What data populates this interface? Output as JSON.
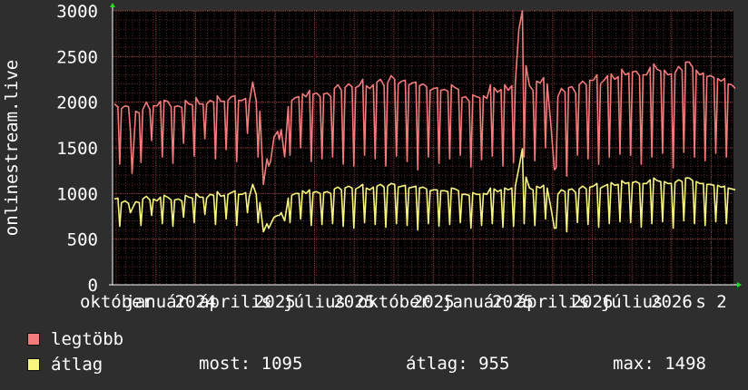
{
  "chart_data": {
    "type": "line",
    "ylabel": "onlinestream.live",
    "ylim": [
      0,
      3000
    ],
    "yticks": [
      0,
      500,
      1000,
      1500,
      2000,
      2500,
      3000
    ],
    "x_tick_labels": [
      "október",
      "január",
      "2024",
      "április",
      "2025",
      "július",
      "2025",
      "október",
      "2025",
      "január",
      "2025",
      "április",
      "2026",
      "július",
      "2026",
      "s 2"
    ],
    "grid": true,
    "series": [
      {
        "name": "legtöbb",
        "color": "#f47b7b",
        "values": [
          1980,
          1950,
          1930,
          1960,
          1950,
          1220,
          1900,
          1880,
          1920,
          2000,
          1920,
          1960,
          1960,
          2010,
          2020,
          2010,
          1950,
          1950,
          1960,
          1940,
          2020,
          1980,
          1970,
          2050,
          1980,
          1980,
          1980,
          2020,
          2000,
          2070,
          2010,
          2010,
          2020,
          2060,
          2070,
          2020,
          2020,
          2040,
          1990,
          2220,
          2010,
          1900,
          1100,
          1380,
          1350,
          1620,
          1680,
          1700,
          1400,
          1950,
          2020,
          2050,
          2060,
          2090,
          2060,
          2130,
          2090,
          2100,
          2060,
          2090,
          2100,
          2060,
          2150,
          2190,
          2130,
          2160,
          2200,
          2170,
          2160,
          2180,
          2250,
          2180,
          2150,
          2190,
          2220,
          2250,
          2180,
          2210,
          2290,
          2250,
          2200,
          2230,
          2240,
          2190,
          2210,
          2220,
          2180,
          2200,
          2170,
          2130,
          2150,
          2160,
          2130,
          2140,
          2120,
          2190,
          2160,
          2140,
          2050,
          2060,
          2010,
          2080,
          2060,
          2050,
          2070,
          2040,
          2190,
          2160,
          2110,
          2140,
          2190,
          2130,
          2180,
          2210,
          2800,
          3000,
          2400,
          2180,
          2130,
          2230,
          2210,
          2270,
          2200,
          1760,
          1260,
          2060,
          2150,
          2110,
          2160,
          2170,
          2100,
          2190,
          2230,
          2190,
          2240,
          2240,
          2300,
          2200,
          2240,
          2290,
          2310,
          2250,
          2280,
          2360,
          2300,
          2320,
          2330,
          2340,
          2290,
          2300,
          2300,
          2380,
          2420,
          2360,
          2340,
          2350,
          2300,
          2310,
          2320,
          2390,
          2350,
          2440,
          2440,
          2380,
          2350,
          2300,
          2320,
          2280,
          2290,
          2270,
          2260,
          2230,
          2260,
          2200,
          2190,
          2150
        ],
        "dips": [
          1320,
          1700,
          1340,
          1580,
          1400,
          1330,
          1550,
          1410,
          1600,
          1380,
          1480,
          1350,
          1660,
          1400,
          1300,
          1590,
          1420,
          1500,
          1350,
          1380,
          1400,
          1320,
          1300,
          1420,
          1380,
          1300,
          1410,
          1350,
          1260,
          1400,
          1330,
          1380,
          1420,
          1290,
          1370,
          1410,
          1300,
          1340,
          1400,
          1360,
          1500,
          1280,
          1190,
          1420,
          1380,
          1320,
          1400,
          1430,
          1420,
          1320,
          1400,
          1440,
          1280,
          1450,
          1400,
          1360,
          1440,
          1400,
          1410,
          1390,
          1440,
          1420,
          1370,
          1330,
          1380,
          1400,
          1420,
          1430,
          1390,
          1410
        ]
      },
      {
        "name": "átlag",
        "color": "#f6f57e",
        "values": [
          940,
          950,
          900,
          920,
          890,
          830,
          910,
          900,
          940,
          970,
          930,
          940,
          920,
          960,
          980,
          960,
          930,
          930,
          940,
          920,
          980,
          960,
          950,
          1000,
          960,
          960,
          950,
          990,
          980,
          1020,
          970,
          980,
          990,
          1010,
          1030,
          990,
          990,
          1010,
          960,
          1100,
          990,
          900,
          580,
          670,
          660,
          740,
          760,
          790,
          700,
          950,
          980,
          1000,
          1000,
          1030,
          1000,
          1040,
          1010,
          1020,
          1000,
          1010,
          1020,
          1000,
          1050,
          1070,
          1040,
          1060,
          1080,
          1060,
          1050,
          1070,
          1100,
          1060,
          1040,
          1070,
          1080,
          1100,
          1070,
          1080,
          1110,
          1100,
          1070,
          1080,
          1090,
          1060,
          1070,
          1080,
          1060,
          1070,
          1050,
          1030,
          1040,
          1040,
          1030,
          1030,
          1020,
          1060,
          1050,
          1030,
          990,
          990,
          980,
          1010,
          990,
          990,
          1000,
          990,
          1060,
          1050,
          1020,
          1040,
          1060,
          1040,
          1060,
          1080,
          1280,
          1490,
          1180,
          1060,
          1040,
          1080,
          1060,
          1090,
          1060,
          850,
          620,
          990,
          1040,
          1020,
          1040,
          1050,
          1010,
          1050,
          1080,
          1050,
          1070,
          1080,
          1110,
          1060,
          1080,
          1100,
          1120,
          1090,
          1100,
          1140,
          1110,
          1120,
          1120,
          1130,
          1110,
          1110,
          1110,
          1150,
          1170,
          1140,
          1130,
          1130,
          1110,
          1110,
          1120,
          1150,
          1130,
          1170,
          1170,
          1140,
          1130,
          1110,
          1110,
          1100,
          1100,
          1090,
          1090,
          1070,
          1080,
          1060,
          1050,
          1040
        ],
        "dips": [
          640,
          790,
          650,
          760,
          670,
          640,
          740,
          680,
          770,
          660,
          720,
          650,
          790,
          680,
          620,
          760,
          680,
          720,
          650,
          660,
          670,
          640,
          620,
          680,
          660,
          630,
          670,
          650,
          600,
          670,
          640,
          660,
          680,
          620,
          650,
          670,
          630,
          640,
          670,
          650,
          720,
          620,
          580,
          680,
          660,
          630,
          670,
          690,
          680,
          630,
          670,
          690,
          620,
          700,
          670,
          650,
          690,
          670,
          670,
          660,
          690,
          680,
          650,
          630,
          660,
          670,
          680,
          690,
          660,
          670
        ]
      }
    ]
  },
  "legend": [
    {
      "label": "legtöbb",
      "color": "#f47b7b"
    },
    {
      "label": "átlag",
      "color": "#f6f57e"
    }
  ],
  "stats": {
    "most": "most: 1095",
    "atlag": "átlag: 955",
    "max": "max: 1498"
  }
}
